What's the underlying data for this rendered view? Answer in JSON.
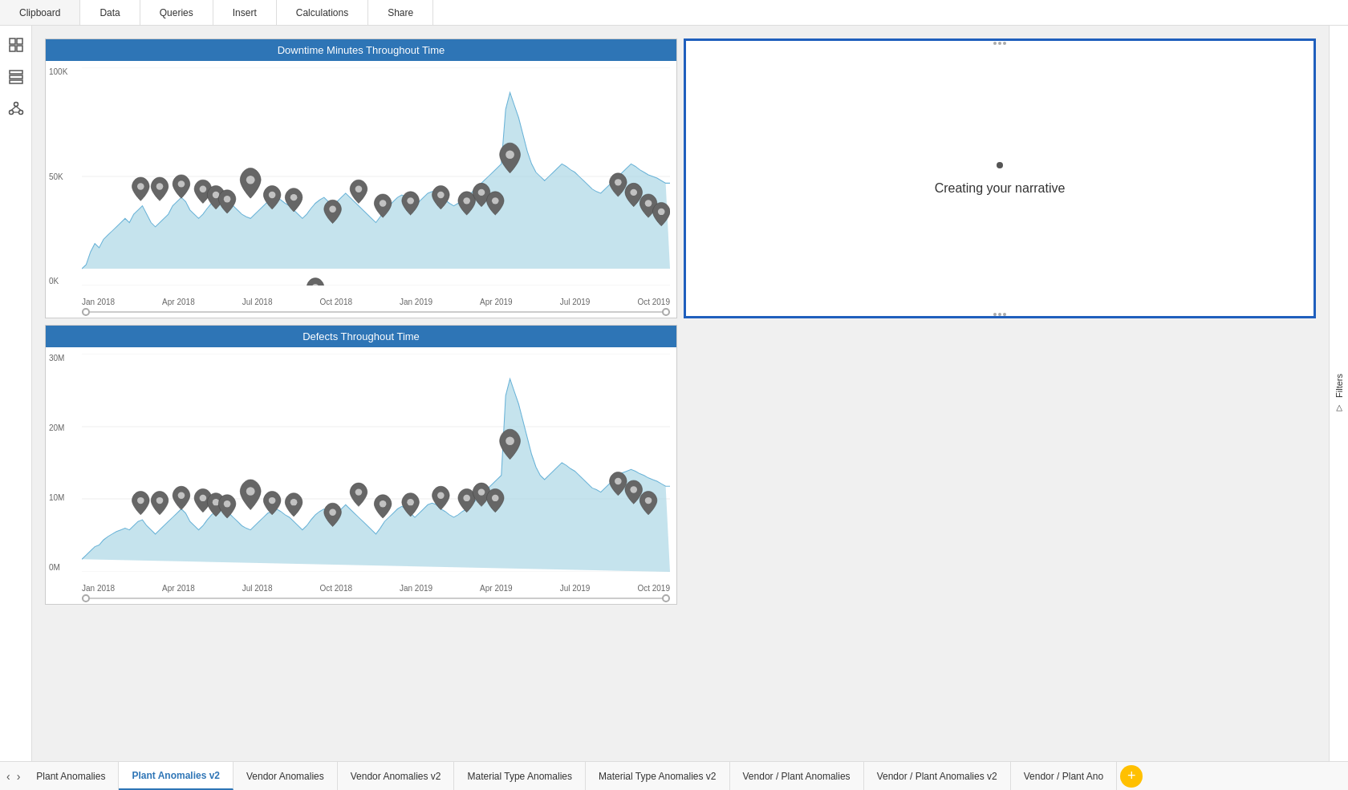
{
  "toolbar": {
    "items": [
      "Clipboard",
      "Data",
      "Queries",
      "Insert",
      "Calculations",
      "Share"
    ]
  },
  "sidebar": {
    "icons": [
      {
        "name": "report-icon",
        "symbol": "⊞"
      },
      {
        "name": "data-icon",
        "symbol": "⊟"
      },
      {
        "name": "model-icon",
        "symbol": "⊠"
      }
    ]
  },
  "charts": {
    "top_left": {
      "title": "Downtime Minutes Throughout Time",
      "y_labels": [
        "100K",
        "50K",
        "0K"
      ],
      "x_labels": [
        "Jan 2018",
        "Apr 2018",
        "Jul 2018",
        "Oct 2018",
        "Jan 2019",
        "Apr 2019",
        "Jul 2019",
        "Oct 2019"
      ]
    },
    "top_right": {
      "title": "Creating your narrative",
      "loading_text": "Creating your narrative"
    },
    "bottom_left": {
      "title": "Defects Throughout Time",
      "y_labels": [
        "30M",
        "20M",
        "10M",
        "0M"
      ],
      "x_labels": [
        "Jan 2018",
        "Apr 2018",
        "Jul 2018",
        "Oct 2018",
        "Jan 2019",
        "Apr 2019",
        "Jul 2019",
        "Oct 2019"
      ]
    }
  },
  "filters": {
    "label": "Filters",
    "arrow_symbol": "▽"
  },
  "tabs": {
    "items": [
      {
        "label": "Plant Anomalies",
        "active": false
      },
      {
        "label": "Plant Anomalies v2",
        "active": true
      },
      {
        "label": "Vendor Anomalies",
        "active": false
      },
      {
        "label": "Vendor Anomalies v2",
        "active": false
      },
      {
        "label": "Material Type Anomalies",
        "active": false
      },
      {
        "label": "Material Type Anomalies v2",
        "active": false
      },
      {
        "label": "Vendor / Plant Anomalies",
        "active": false
      },
      {
        "label": "Vendor / Plant Anomalies v2",
        "active": false
      },
      {
        "label": "Vendor / Plant Ano",
        "active": false
      }
    ],
    "add_label": "+"
  }
}
